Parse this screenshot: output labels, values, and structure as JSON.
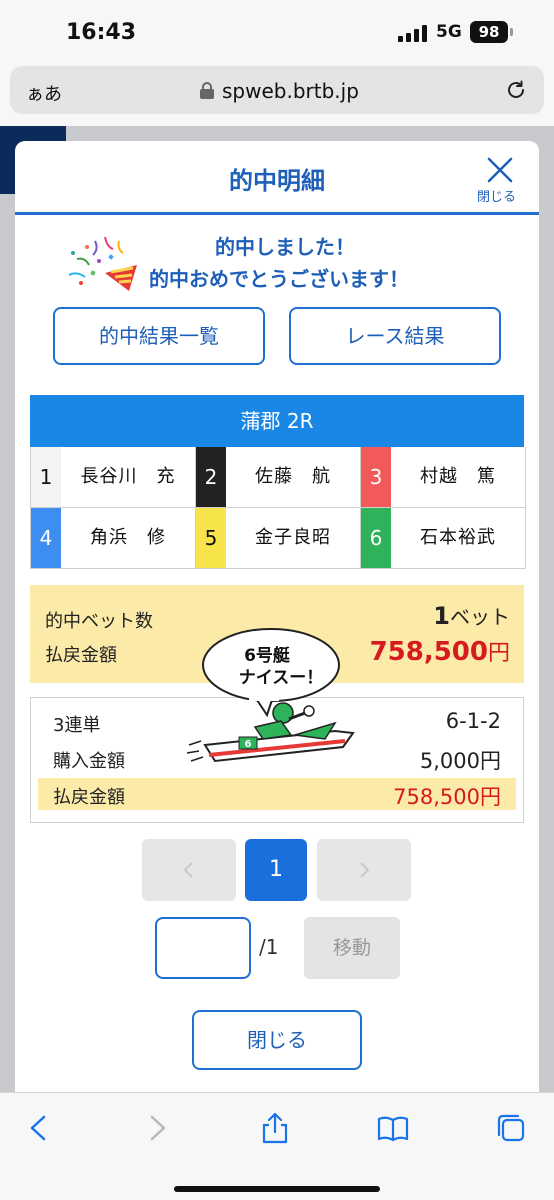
{
  "status": {
    "time": "16:43",
    "network": "5G",
    "battery": "98"
  },
  "browser": {
    "aa_label": "ぁあ",
    "url": "spweb.brtb.jp"
  },
  "modal": {
    "title": "的中明細",
    "close_label": "閉じる",
    "congrats_line1": "的中しました！",
    "congrats_line2": "的中おめでとうございます！",
    "btn_results_label": "的中結果一覧",
    "btn_race_label": "レース結果",
    "race_header": "蒲郡 2R",
    "racers": [
      {
        "num": "1",
        "name": "長谷川　充",
        "color": "#ffffff",
        "text_color": "#111111"
      },
      {
        "num": "2",
        "name": "佐藤　航",
        "color": "#222222",
        "text_color": "#ffffff"
      },
      {
        "num": "3",
        "name": "村越　篤",
        "color": "#f25a5a",
        "text_color": "#ffffff"
      },
      {
        "num": "4",
        "name": "角浜　修",
        "color": "#3d8ef0",
        "text_color": "#ffffff"
      },
      {
        "num": "5",
        "name": "金子良昭",
        "color": "#f7e34a",
        "text_color": "#111111"
      },
      {
        "num": "6",
        "name": "石本裕武",
        "color": "#2fb35a",
        "text_color": "#ffffff"
      }
    ],
    "summary": {
      "bet_count_label": "的中ベット数",
      "bet_count": "1",
      "bet_unit": "ベット",
      "payout_label": "払戻金額",
      "payout": "758,500",
      "yen": "円"
    },
    "speech_bubble": {
      "line1": "6号艇",
      "line2": "ナイスー！"
    },
    "boat_number": "6",
    "detail": {
      "type_label": "3連単",
      "type_value": "6-1-2",
      "purchase_label": "購入金額",
      "purchase_value": "5,000円",
      "payout_label": "払戻金額",
      "payout_value": "758,500円"
    },
    "pager": {
      "current": "1",
      "total_label": "/1",
      "go_label": "移動"
    },
    "close_button": "閉じる"
  },
  "colors": {
    "accent": "#1e6fd0",
    "highlight": "#fbeaa8",
    "payout_red": "#d71920",
    "race_header": "#1a86e6"
  }
}
